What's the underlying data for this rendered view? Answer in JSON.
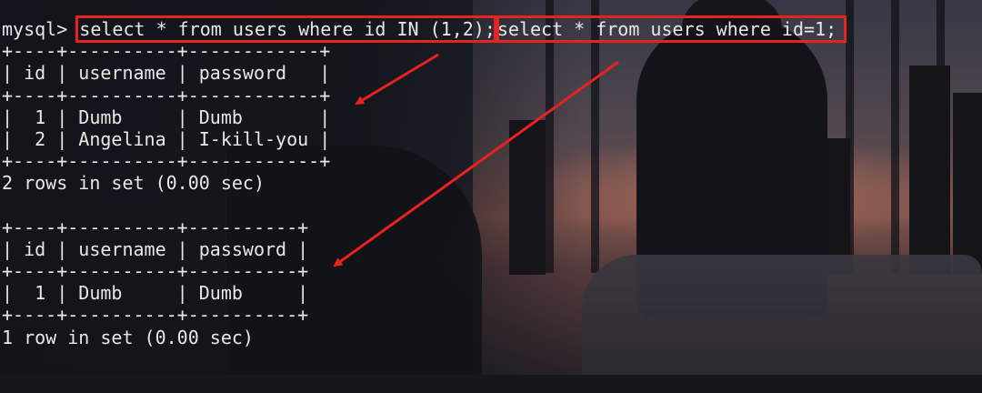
{
  "terminal": {
    "prompt": "mysql> ",
    "query1": "select * from users where id IN (1,2);",
    "query2": "select * from users where id=1;",
    "result1": {
      "border": "+----+----------+------------+",
      "header": "| id | username | password   |",
      "rows": [
        "|  1 | Dumb     | Dumb       |",
        "|  2 | Angelina | I-kill-you |"
      ],
      "status": "2 rows in set (0.00 sec)"
    },
    "result2": {
      "border": "+----+----------+----------+",
      "header": "| id | username | password |",
      "rows": [
        "|  1 | Dumb     | Dumb     |"
      ],
      "status": "1 row in set (0.00 sec)"
    },
    "cursor_line": "    -"
  },
  "colors": {
    "annotation": "#e8221f",
    "text": "#e8e8e8"
  }
}
